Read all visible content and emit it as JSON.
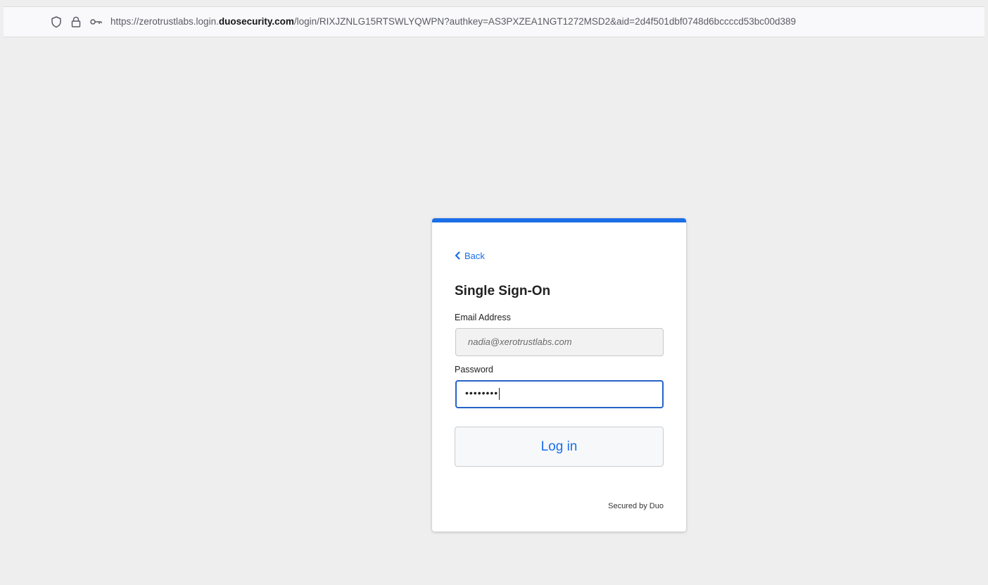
{
  "browser": {
    "url_prefix": "https://zerotrustlabs.login.",
    "url_domain": "duosecurity.com",
    "url_suffix": "/login/RIXJZNLG15RTSWLYQWPN?authkey=AS3PXZEA1NGT1272MSD2&aid=2d4f501dbf0748d6bccccd53bc00d389",
    "icons": [
      "shield-icon",
      "lock-icon",
      "key-icon"
    ]
  },
  "login_card": {
    "accent_color": "#1a6ee8",
    "back_label": "Back",
    "title": "Single Sign-On",
    "email": {
      "label": "Email Address",
      "value": "nadia@xerotrustlabs.com"
    },
    "password": {
      "label": "Password",
      "masked_value": "••••••••"
    },
    "login_button": "Log in",
    "footer": "Secured by Duo"
  }
}
